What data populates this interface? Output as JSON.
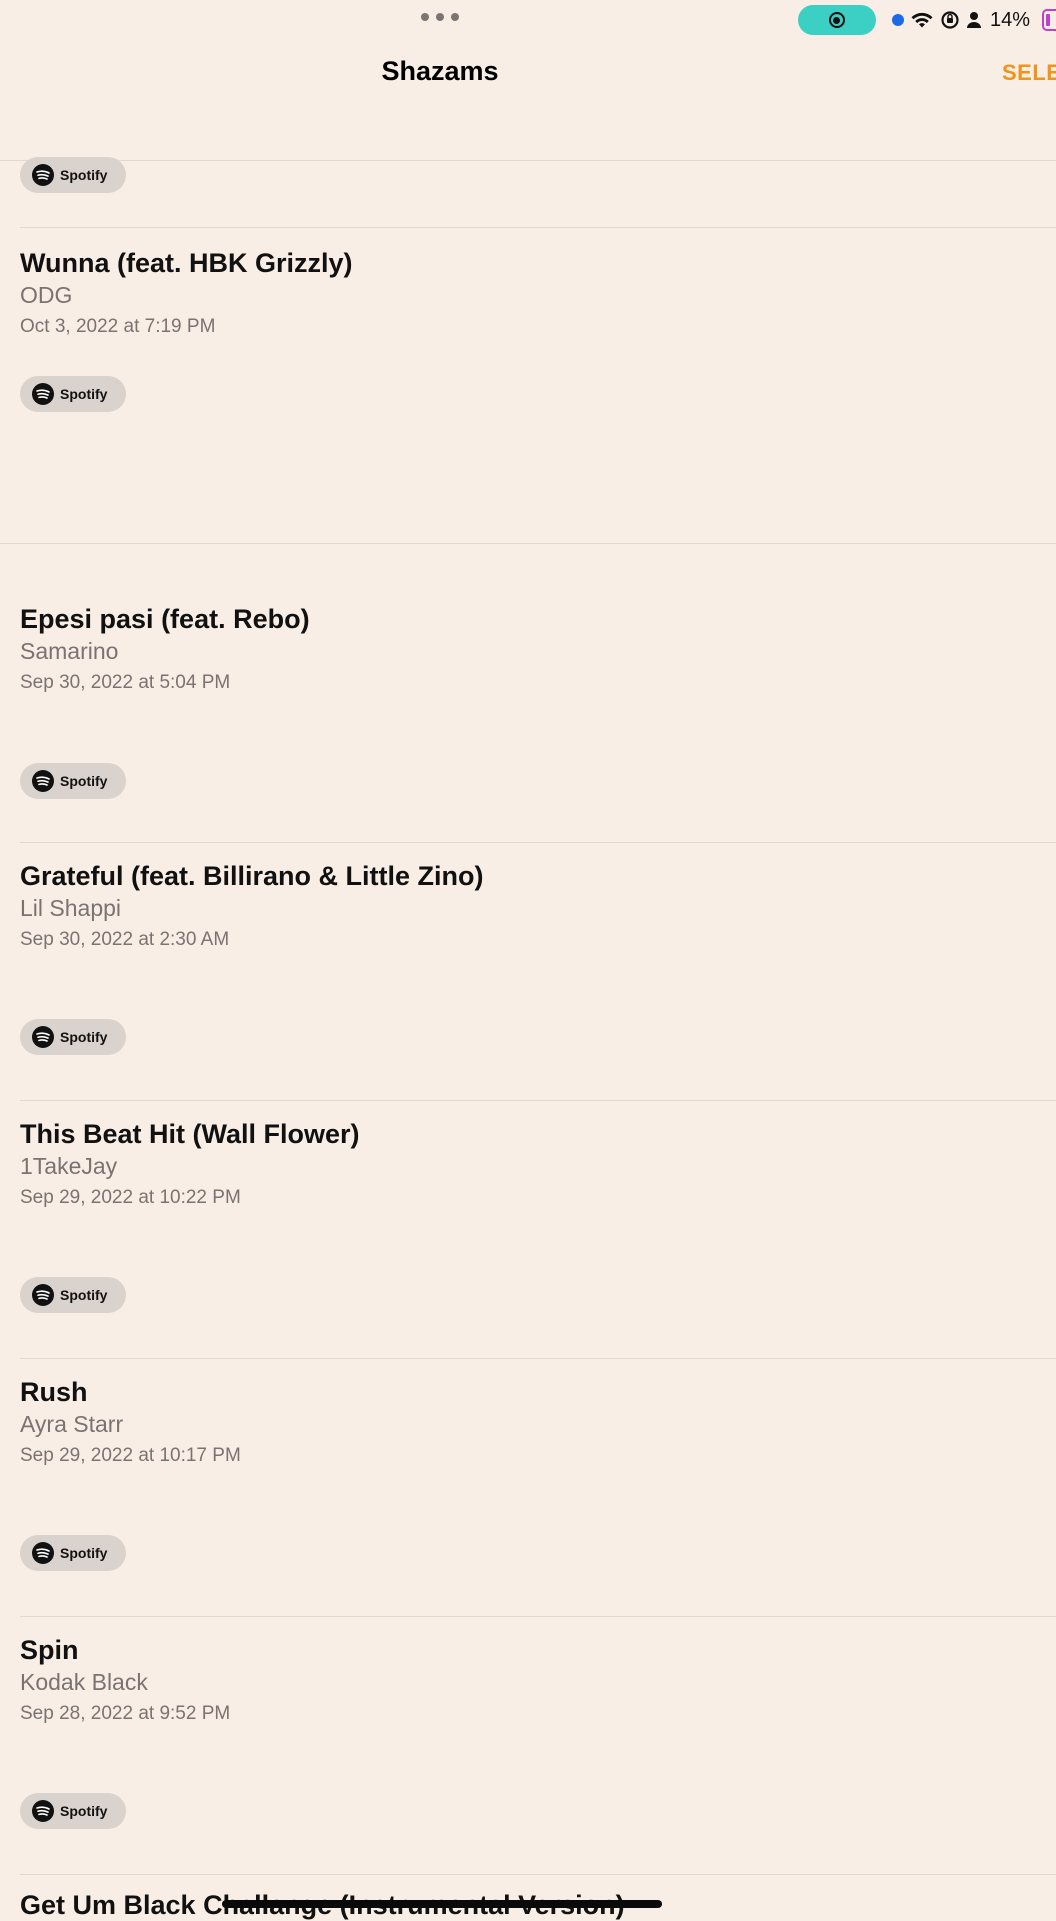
{
  "status": {
    "battery_percent": "14%",
    "record_color": "#3ccfc4",
    "battery_color": "#c040c8"
  },
  "nav": {
    "title": "Shazams",
    "select_label": "SELECT",
    "accent_color": "#f0941b"
  },
  "spotify_label": "Spotify",
  "items": [
    {
      "title": "Wunna (feat. HBK Grizzly)",
      "artist": "ODG",
      "date": "Oct 3, 2022 at 7:19 PM"
    },
    {
      "title": "Epesi pasi (feat. Rebo)",
      "artist": "Samarino",
      "date": "Sep 30, 2022 at 5:04 PM"
    },
    {
      "title": "Grateful (feat. Billirano & Little Zino)",
      "artist": "Lil Shappi",
      "date": "Sep 30, 2022 at 2:30 AM"
    },
    {
      "title": "This Beat Hit (Wall Flower)",
      "artist": "1TakeJay",
      "date": "Sep 29, 2022 at 10:22 PM"
    },
    {
      "title": "Rush",
      "artist": "Ayra Starr",
      "date": "Sep 29, 2022 at 10:17 PM"
    },
    {
      "title": "Spin",
      "artist": "Kodak Black",
      "date": "Sep 28, 2022 at 9:52 PM"
    }
  ],
  "last_item_title": "Get Um Black Challange (Instrumental Version)"
}
